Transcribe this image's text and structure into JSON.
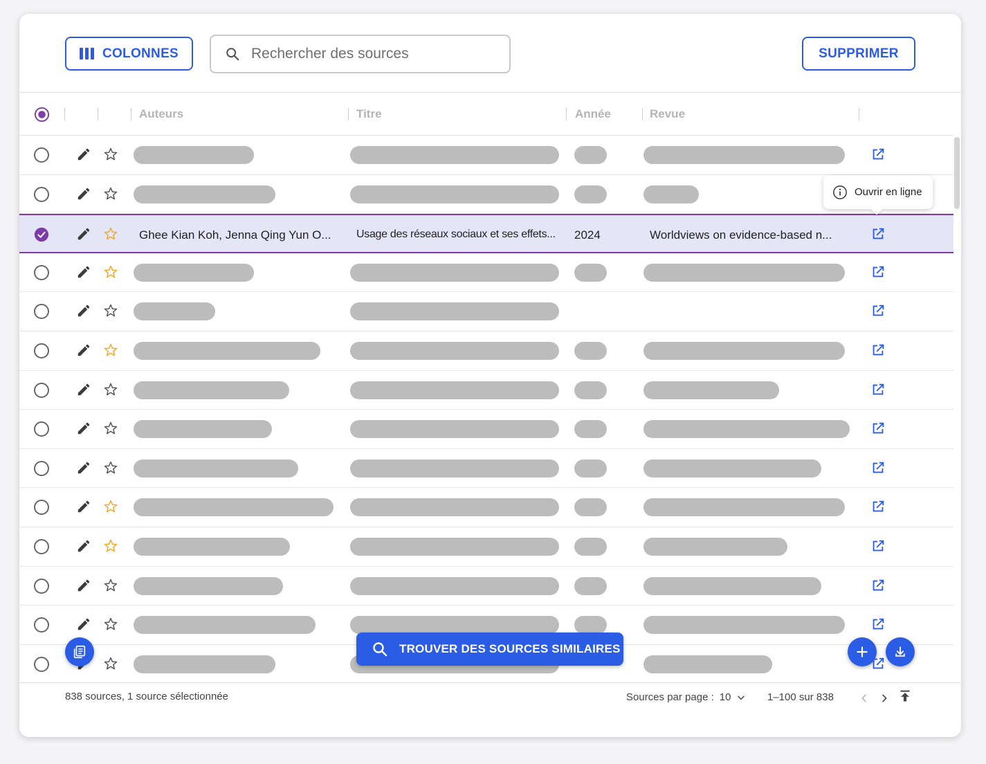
{
  "toolbar": {
    "columns_label": "COLONNES",
    "search_placeholder": "Rechercher des sources",
    "delete_label": "SUPPRIMER"
  },
  "table": {
    "headers": [
      "Auteurs",
      "Titre",
      "Année",
      "Revue"
    ],
    "selected_row": {
      "authors": "Ghee Kian Koh, Jenna Qing Yun O...",
      "title": "Usage des réseaux sociaux et ses effets...",
      "year": "2024",
      "journal": "Worldviews on evidence-based n..."
    },
    "rows": [
      {
        "starred": false,
        "selected": false
      },
      {
        "starred": false,
        "selected": false
      },
      {
        "starred": true,
        "selected": true
      },
      {
        "starred": true,
        "selected": false
      },
      {
        "starred": false,
        "selected": false
      },
      {
        "starred": true,
        "selected": false
      },
      {
        "starred": false,
        "selected": false
      },
      {
        "starred": false,
        "selected": false
      },
      {
        "starred": false,
        "selected": false
      },
      {
        "starred": true,
        "selected": false
      },
      {
        "starred": true,
        "selected": false
      },
      {
        "starred": false,
        "selected": false
      },
      {
        "starred": false,
        "selected": false
      },
      {
        "starred": false,
        "selected": false
      }
    ]
  },
  "tooltip": {
    "text": "Ouvrir en ligne"
  },
  "actions": {
    "find_similar_label": "TROUVER DES SOURCES SIMILAIRES"
  },
  "footer": {
    "summary": "838 sources, 1 source sélectionnée",
    "per_page_label": "Sources par page :",
    "per_page_value": "10",
    "range": "1–100 sur 838"
  },
  "colors": {
    "accent": "#2b5ce6",
    "selection": "#7d3ca8",
    "star": "#f5a623",
    "placeholder_bar": "#bcbcbc"
  }
}
